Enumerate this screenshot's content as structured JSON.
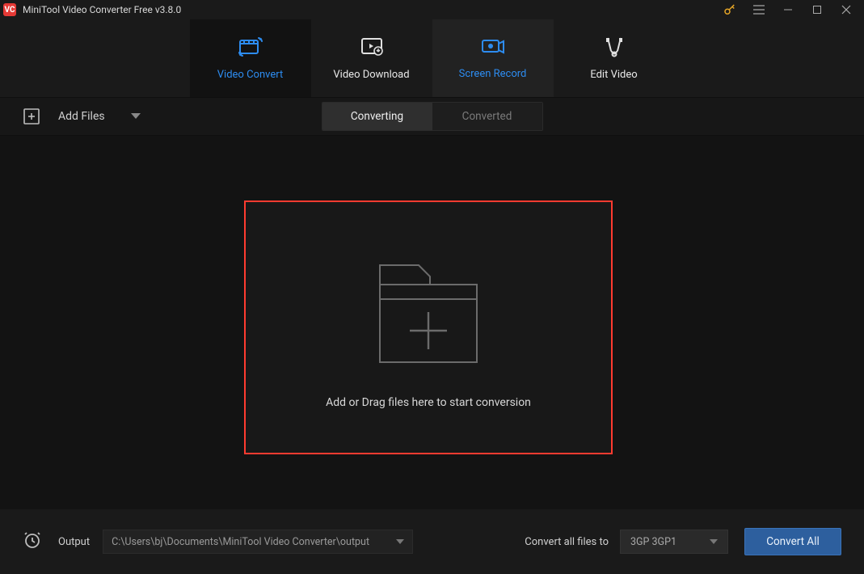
{
  "titlebar": {
    "app_logo_text": "VC",
    "app_title": "MiniTool Video Converter Free v3.8.0"
  },
  "nav": {
    "tabs": [
      {
        "label": "Video Convert"
      },
      {
        "label": "Video Download"
      },
      {
        "label": "Screen Record"
      },
      {
        "label": "Edit Video"
      }
    ]
  },
  "toolbar": {
    "add_files_label": "Add Files",
    "converting_label": "Converting",
    "converted_label": "Converted"
  },
  "dropzone": {
    "text": "Add or Drag files here to start conversion"
  },
  "bottom": {
    "output_label": "Output",
    "output_path": "C:\\Users\\bj\\Documents\\MiniTool Video Converter\\output",
    "convert_all_label": "Convert all files to",
    "format_value": "3GP 3GP1",
    "convert_button": "Convert All"
  },
  "colors": {
    "accent": "#2d8cf0",
    "highlight_border": "#ff3b30",
    "key_icon": "#e5a526",
    "convert_btn_bg": "#2d5f9e"
  }
}
